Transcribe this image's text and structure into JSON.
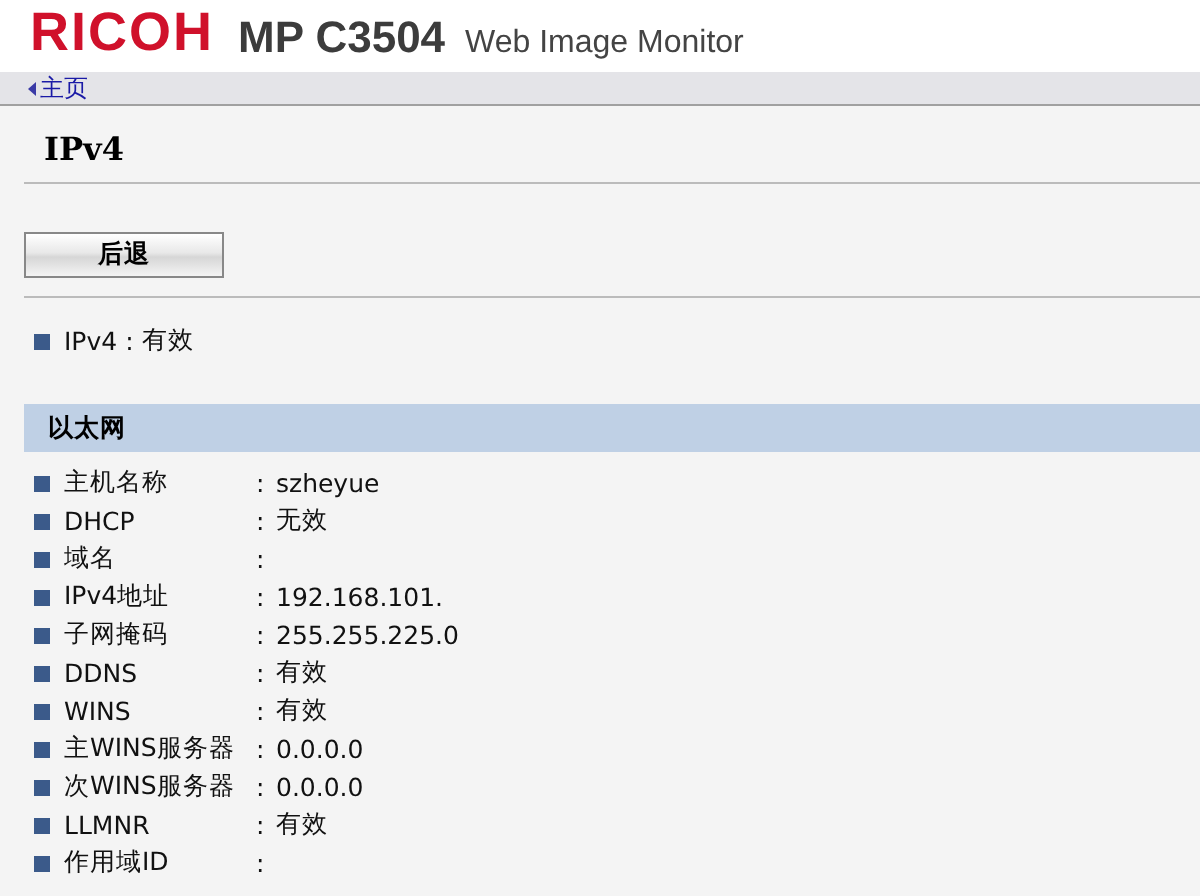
{
  "header": {
    "brand": "RICOH",
    "model": "MP C3504",
    "product": "Web Image Monitor"
  },
  "nav": {
    "home_link": "主页"
  },
  "page_title": "IPv4",
  "back_button": "后退",
  "summary": [
    {
      "label": "IPv4",
      "separator": ":",
      "value": "有效"
    }
  ],
  "section": {
    "title": "以太网",
    "rows": [
      {
        "label": "主机名称",
        "separator": ":",
        "value": "szheyue"
      },
      {
        "label": "DHCP",
        "separator": ":",
        "value": "无效"
      },
      {
        "label": "域名",
        "separator": ":"
      },
      {
        "label": "IPv4地址",
        "separator": ":",
        "value": "192.168.101."
      },
      {
        "label": "子网掩码",
        "separator": ":",
        "value": "255.255.225.0"
      },
      {
        "label": "DDNS",
        "separator": ":",
        "value": "有效"
      },
      {
        "label": "WINS",
        "separator": ":",
        "value": "有效"
      },
      {
        "label": "主WINS服务器",
        "separator": ":",
        "value": "0.0.0.0"
      },
      {
        "label": "次WINS服务器",
        "separator": ":",
        "value": "0.0.0.0"
      },
      {
        "label": "LLMNR",
        "separator": ":",
        "value": "有效"
      },
      {
        "label": "作用域ID",
        "separator": ":"
      }
    ]
  }
}
